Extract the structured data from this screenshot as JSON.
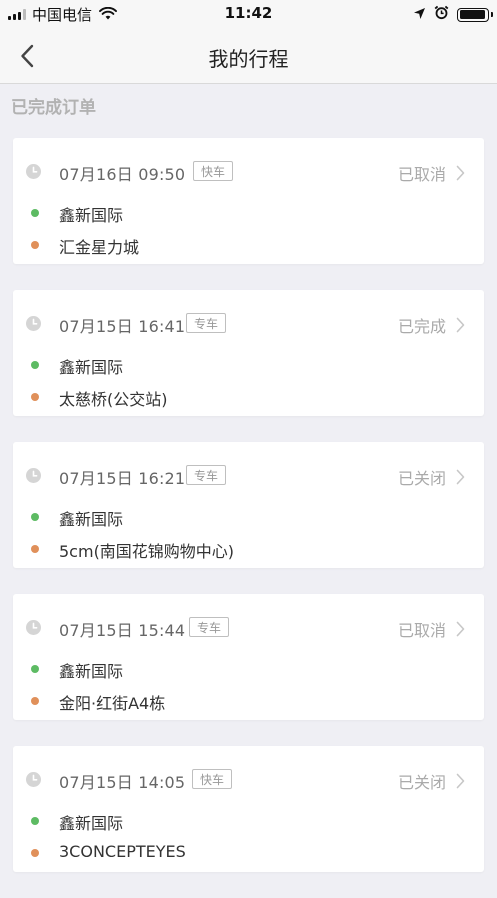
{
  "status_bar": {
    "carrier": "中国电信",
    "time": "11:42",
    "battery_level": 0.95
  },
  "nav": {
    "title": "我的行程"
  },
  "section": {
    "title": "已完成订单"
  },
  "colors": {
    "start_dot": "#5dbb63",
    "end_dot": "#e0905a"
  },
  "trips": [
    {
      "time": "07月16日 09:50",
      "car_type": "快车",
      "status": "已取消",
      "start": "鑫新国际",
      "end": "汇金星力城"
    },
    {
      "time": "07月15日 16:41",
      "car_type": "专车",
      "status": "已完成",
      "start": "鑫新国际",
      "end": "太慈桥(公交站)"
    },
    {
      "time": "07月15日 16:21",
      "car_type": "专车",
      "status": "已关闭",
      "start": "鑫新国际",
      "end": "5cm(南国花锦购物中心)"
    },
    {
      "time": "07月15日 15:44",
      "car_type": "专车",
      "status": "已取消",
      "start": "鑫新国际",
      "end": "金阳·红街A4栋"
    },
    {
      "time": "07月15日 14:05",
      "car_type": "快车",
      "status": "已关闭",
      "start": "鑫新国际",
      "end": "3CONCEPTEYES"
    }
  ]
}
